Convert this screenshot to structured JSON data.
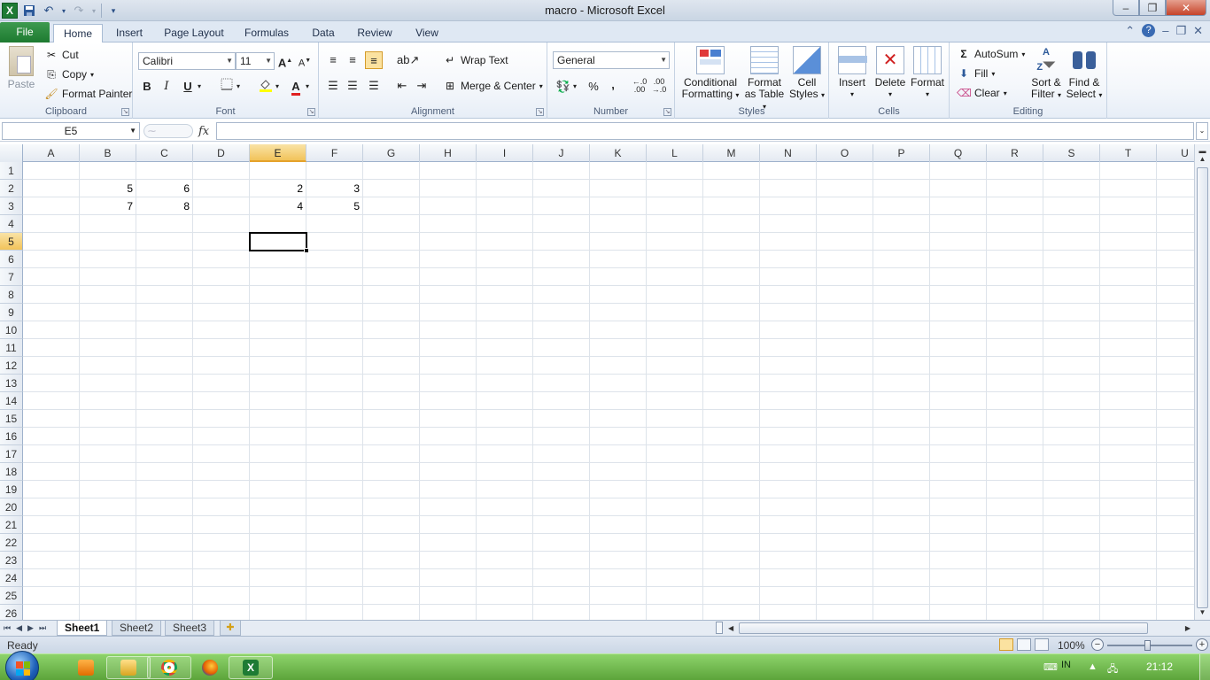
{
  "window": {
    "app_icon": "excel-icon",
    "title": "macro  -  Microsoft Excel",
    "controls": {
      "minimize": "–",
      "restore": "❐",
      "close": "✕"
    }
  },
  "qat": {
    "save": "save-icon",
    "undo": "undo-icon",
    "redo": "redo-icon"
  },
  "tabs": [
    {
      "label": "File"
    },
    {
      "label": "Home"
    },
    {
      "label": "Insert"
    },
    {
      "label": "Page Layout"
    },
    {
      "label": "Formulas"
    },
    {
      "label": "Data"
    },
    {
      "label": "Review"
    },
    {
      "label": "View"
    }
  ],
  "ribbon": {
    "clipboard": {
      "label": "Clipboard",
      "paste": "Paste",
      "cut": "Cut",
      "copy": "Copy",
      "format_painter": "Format Painter"
    },
    "font": {
      "label": "Font",
      "font_name": "Calibri",
      "font_size": "11",
      "bold": "B",
      "italic": "I",
      "underline": "U"
    },
    "alignment": {
      "label": "Alignment",
      "wrap_text": "Wrap Text",
      "merge_center": "Merge & Center"
    },
    "number": {
      "label": "Number",
      "format": "General",
      "percent": "%",
      "comma": ",",
      "inc_decimal": "←.0\n.00",
      "dec_decimal": ".00\n→.0"
    },
    "styles": {
      "label": "Styles",
      "conditional_1": "Conditional",
      "conditional_2": "Formatting",
      "format_table_1": "Format",
      "format_table_2": "as Table",
      "cell_styles_1": "Cell",
      "cell_styles_2": "Styles"
    },
    "cells": {
      "label": "Cells",
      "insert": "Insert",
      "delete": "Delete",
      "format": "Format"
    },
    "editing": {
      "label": "Editing",
      "autosum": "AutoSum",
      "fill": "Fill",
      "clear": "Clear",
      "sort_1": "Sort &",
      "sort_2": "Filter",
      "find_1": "Find &",
      "find_2": "Select"
    }
  },
  "formula_bar": {
    "name_box": "E5",
    "fx": "fx",
    "formula": ""
  },
  "grid": {
    "columns": [
      "A",
      "B",
      "C",
      "D",
      "E",
      "F",
      "G",
      "H",
      "I",
      "J",
      "K",
      "L",
      "M",
      "N",
      "O",
      "P",
      "Q",
      "R",
      "S",
      "T",
      "U"
    ],
    "rows": 26,
    "selected_col": "E",
    "selected_row": 5,
    "cells": [
      {
        "ref": "B2",
        "value": "5"
      },
      {
        "ref": "C2",
        "value": "6"
      },
      {
        "ref": "E2",
        "value": "2"
      },
      {
        "ref": "F2",
        "value": "3"
      },
      {
        "ref": "B3",
        "value": "7"
      },
      {
        "ref": "C3",
        "value": "8"
      },
      {
        "ref": "E3",
        "value": "4"
      },
      {
        "ref": "F3",
        "value": "5"
      }
    ]
  },
  "sheets": [
    {
      "name": "Sheet1",
      "active": true
    },
    {
      "name": "Sheet2",
      "active": false
    },
    {
      "name": "Sheet3",
      "active": false
    }
  ],
  "status": {
    "mode": "Ready",
    "zoom": "100%"
  },
  "taskbar": {
    "apps": [
      "media-player-icon",
      "file-explorer-icon",
      "chrome-icon",
      "firefox-icon",
      "excel-icon"
    ],
    "language": "IN",
    "time": "21:12"
  },
  "colors": {
    "excel_green": "#1e7b34",
    "selection_orange": "#f2c35a",
    "taskbar_green": "#5ca43a"
  }
}
